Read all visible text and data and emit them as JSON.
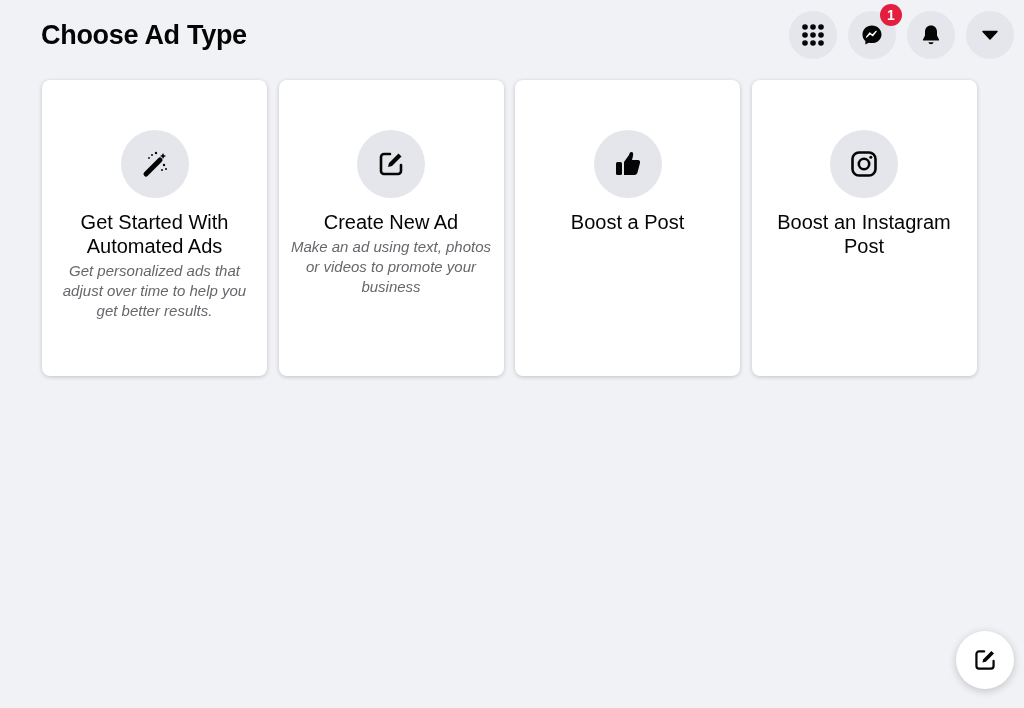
{
  "header": {
    "title": "Choose Ad Type",
    "buttons": [
      {
        "kind": "grid"
      },
      {
        "kind": "messenger",
        "badge": "1"
      },
      {
        "kind": "bell"
      },
      {
        "kind": "caret"
      }
    ]
  },
  "cards": [
    {
      "kind": "wand",
      "title": "Get Started With Automated Ads",
      "description": "Get personalized ads that adjust over time to help you get better results."
    },
    {
      "kind": "edit",
      "title": "Create New Ad",
      "description": "Make an ad using text, photos or videos to promote your business"
    },
    {
      "kind": "thumb",
      "title": "Boost a Post"
    },
    {
      "kind": "instagram",
      "title": "Boost an Instagram Post"
    }
  ],
  "floating_button": {
    "kind": "edit"
  }
}
